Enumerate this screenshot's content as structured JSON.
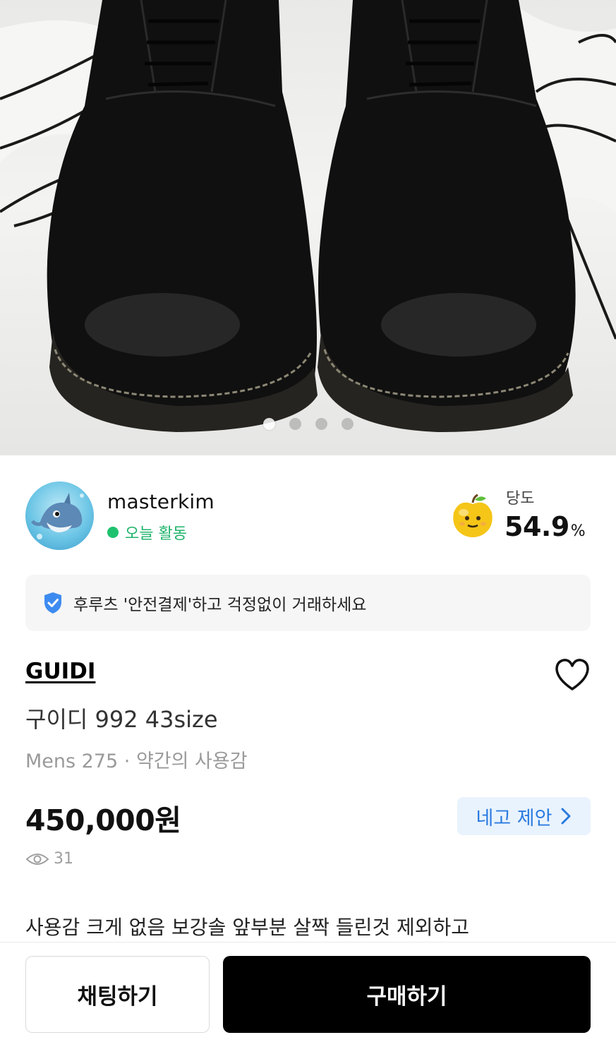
{
  "gallery": {
    "image_alt": "Black leather lace-up boots",
    "slide_count": 4,
    "active_slide": 1
  },
  "seller": {
    "name": "masterkim",
    "activity": "오늘 활동"
  },
  "sweetness": {
    "label": "당도",
    "value": "54.9",
    "unit": "%"
  },
  "safe_payment": {
    "text": "후루츠 '안전결제'하고 걱정없이 거래하세요",
    "icon": "shield-check-icon"
  },
  "product": {
    "brand": "GUIDI",
    "title": "구이디 992 43size",
    "size": "Mens 275",
    "separator": " · ",
    "condition": "약간의 사용감",
    "price": "450,000원",
    "views": "31",
    "description": "사용감 크게 없음  보강솔 앞부분 살짝 들린것 제외하고"
  },
  "actions": {
    "offer_label": "네고 제안",
    "chat_label": "채팅하기",
    "buy_label": "구매하기"
  },
  "colors": {
    "accent_green": "#1fc16f",
    "accent_blue": "#2a7be0",
    "offer_bg": "#e9f3fd",
    "primary_button": "#000000"
  }
}
